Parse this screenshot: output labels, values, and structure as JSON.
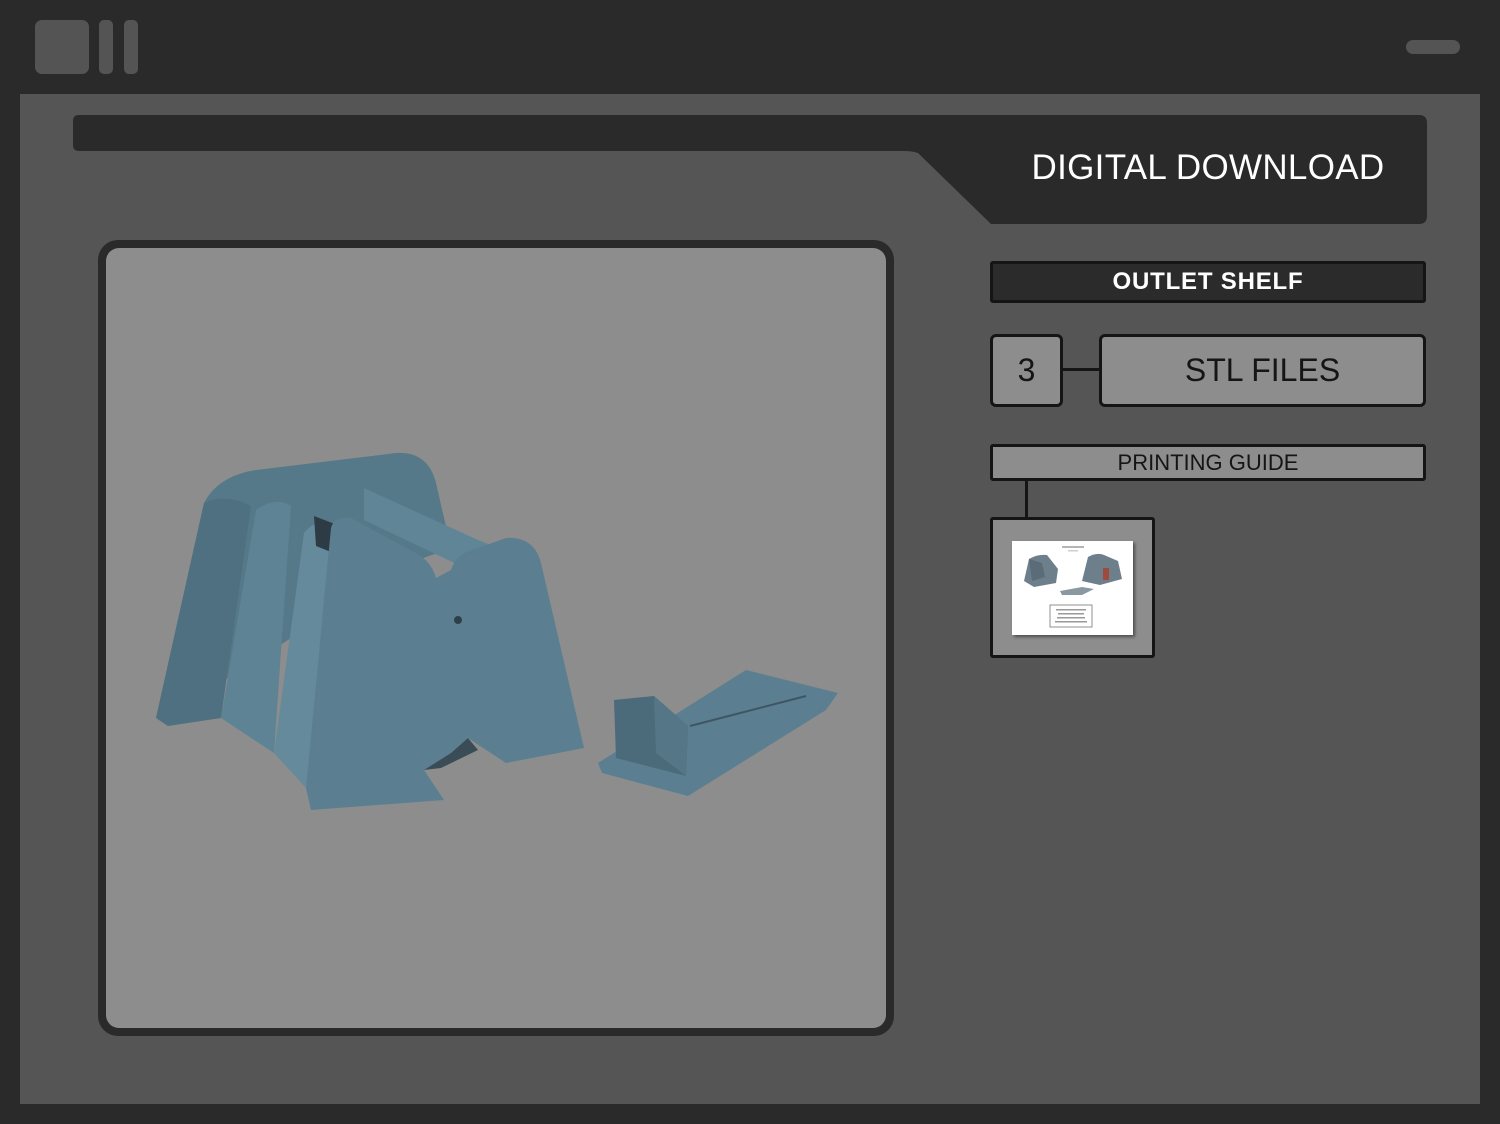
{
  "header": {
    "title": "DIGITAL DOWNLOAD"
  },
  "product": {
    "name": "OUTLET SHELF"
  },
  "files": {
    "count": "3",
    "label": "STL FILES"
  },
  "guide": {
    "label": "PRINTING GUIDE"
  },
  "colors": {
    "frame": "#2a2a2a",
    "panel": "#555555",
    "viewer": "#8d8d8d",
    "model": "#5a7c8d",
    "ink": "#151515"
  },
  "icons": [
    "window-square-icon",
    "window-bar-icon",
    "minimize-pill-icon"
  ]
}
